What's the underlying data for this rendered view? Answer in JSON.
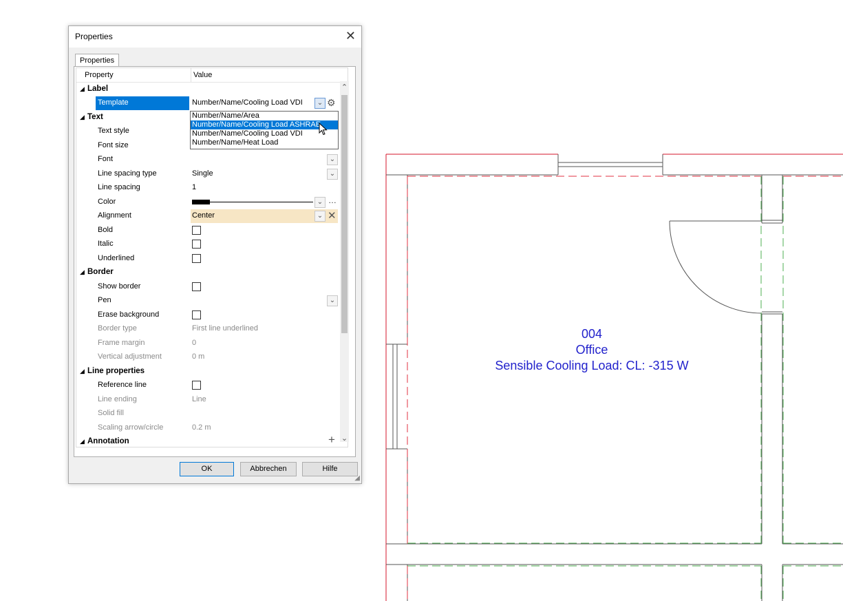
{
  "dialog": {
    "title": "Properties",
    "close_glyph": "✕",
    "tab_label": "Properties",
    "columns": {
      "property": "Property",
      "value": "Value"
    },
    "categories": {
      "label": "Label",
      "text": "Text",
      "border": "Border",
      "line_properties": "Line properties",
      "annotation": "Annotation"
    },
    "rows": {
      "template": {
        "name": "Template",
        "value": "Number/Name/Cooling Load VDI"
      },
      "text_style": {
        "name": "Text style"
      },
      "font_size": {
        "name": "Font size"
      },
      "font": {
        "name": "Font"
      },
      "line_spacing_type": {
        "name": "Line spacing type",
        "value": "Single"
      },
      "line_spacing": {
        "name": "Line spacing",
        "value": "1"
      },
      "color": {
        "name": "Color",
        "value_color": "#000000"
      },
      "alignment": {
        "name": "Alignment",
        "value": "Center"
      },
      "bold": {
        "name": "Bold",
        "checked": false
      },
      "italic": {
        "name": "Italic",
        "checked": false
      },
      "underlined": {
        "name": "Underlined",
        "checked": false
      },
      "show_border": {
        "name": "Show border",
        "checked": false
      },
      "pen": {
        "name": "Pen"
      },
      "erase_background": {
        "name": "Erase background",
        "checked": false
      },
      "border_type": {
        "name": "Border type",
        "value": "First line underlined"
      },
      "frame_margin": {
        "name": "Frame margin",
        "value": "0"
      },
      "vertical_adjustment": {
        "name": "Vertical adjustment",
        "value": "0 m"
      },
      "reference_line": {
        "name": "Reference line",
        "checked": false
      },
      "line_ending": {
        "name": "Line ending",
        "value": "Line"
      },
      "solid_fill": {
        "name": "Solid fill"
      },
      "scaling_arrow_circle": {
        "name": "Scaling arrow/circle",
        "value": "0.2 m"
      }
    },
    "template_options": [
      "Number/Name/Area",
      "Number/Name/Cooling Load ASHRAE",
      "Number/Name/Cooling Load VDI",
      "Number/Name/Heat Load"
    ],
    "template_highlighted_option": "Number/Name/Cooling Load ASHRAE",
    "buttons": {
      "ok": "OK",
      "cancel": "Abbrechen",
      "help": "Hilfe"
    }
  },
  "room_label": {
    "number": "004",
    "name": "Office",
    "load": "Sensible Cooling Load: CL: -315 W"
  },
  "colors": {
    "selection": "#0078d7",
    "room_text": "#2222cc",
    "wall_outline": "#d4142a",
    "room_boundary_red": "#e03040",
    "room_boundary_green": "#4caf50",
    "highlight_row": "#f7e6c5"
  }
}
